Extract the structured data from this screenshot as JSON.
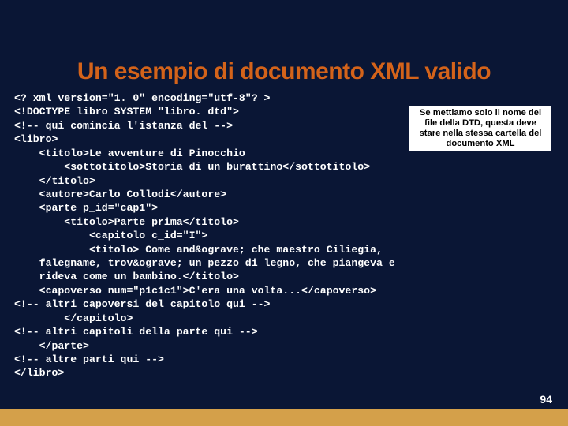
{
  "title": "Un esempio di documento XML valido",
  "callout": "Se mettiamo solo il nome del file della DTD, questa deve stare nella stessa cartella del documento XML",
  "code": "<? xml version=\"1. 0\" encoding=\"utf-8\"? >\n<!DOCTYPE libro SYSTEM \"libro. dtd\">\n<!-- qui comincia l'istanza del -->\n<libro>\n    <titolo>Le avventure di Pinocchio\n        <sottotitolo>Storia di un burattino</sottotitolo>\n    </titolo>\n    <autore>Carlo Collodi</autore>\n    <parte p_id=\"cap1\">\n        <titolo>Parte prima</titolo>\n            <capitolo c_id=\"I\">\n            <titolo> Come and&ograve; che maestro Ciliegia,\n    falegname, trov&ograve; un pezzo di legno, che piangeva e\n    rideva come un bambino.</titolo>\n    <capoverso num=\"p1c1c1\">C'era una volta...</capoverso>\n<!-- altri capoversi del capitolo qui -->\n        </capitolo>\n<!-- altri capitoli della parte qui -->\n    </parte>\n<!-- altre parti qui -->\n</libro>",
  "page": "94"
}
